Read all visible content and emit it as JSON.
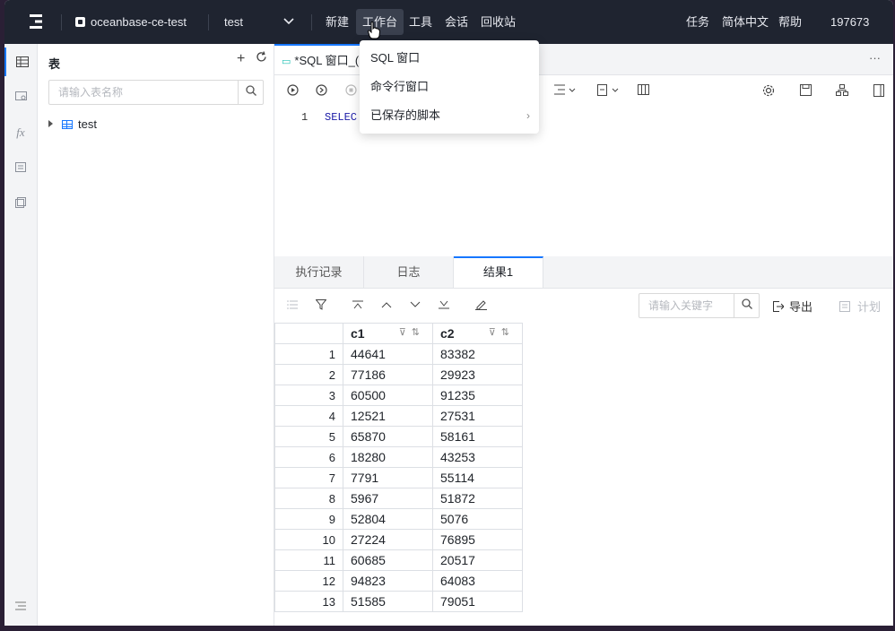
{
  "topbar": {
    "connection_name": "oceanbase-ce-test",
    "database": "test",
    "menu": [
      "新建",
      "工作台",
      "工具",
      "会话",
      "回收站"
    ],
    "right": [
      "任务",
      "简体中文",
      "帮助",
      "197673"
    ]
  },
  "tree": {
    "title": "表",
    "search_placeholder": "请输入表名称",
    "nodes": [
      {
        "label": "test"
      }
    ]
  },
  "editor": {
    "tab_title": "*SQL 窗口_(",
    "line_number": "1",
    "code": "SELEC"
  },
  "dropdown": {
    "items": [
      {
        "label": "SQL 窗口"
      },
      {
        "label": "命令行窗口"
      },
      {
        "label": "已保存的脚本",
        "submenu": true
      }
    ]
  },
  "result_tabs": [
    "执行记录",
    "日志",
    "结果1"
  ],
  "result_toolbar": {
    "keyword_placeholder": "请输入关键字",
    "export_label": "导出",
    "plan_label": "计划"
  },
  "table": {
    "columns": [
      "c1",
      "c2"
    ],
    "rows": [
      [
        "1",
        "44641",
        "83382"
      ],
      [
        "2",
        "77186",
        "29923"
      ],
      [
        "3",
        "60500",
        "91235"
      ],
      [
        "4",
        "12521",
        "27531"
      ],
      [
        "5",
        "65870",
        "58161"
      ],
      [
        "6",
        "18280",
        "43253"
      ],
      [
        "7",
        "7791",
        "55114"
      ],
      [
        "8",
        "5967",
        "51872"
      ],
      [
        "9",
        "52804",
        "5076"
      ],
      [
        "10",
        "27224",
        "76895"
      ],
      [
        "11",
        "60685",
        "20517"
      ],
      [
        "12",
        "94823",
        "64083"
      ],
      [
        "13",
        "51585",
        "79051"
      ]
    ]
  },
  "colors": {
    "accent": "#1677ff",
    "topbar": "#1f2430",
    "keyword": "#1a1aa6"
  }
}
